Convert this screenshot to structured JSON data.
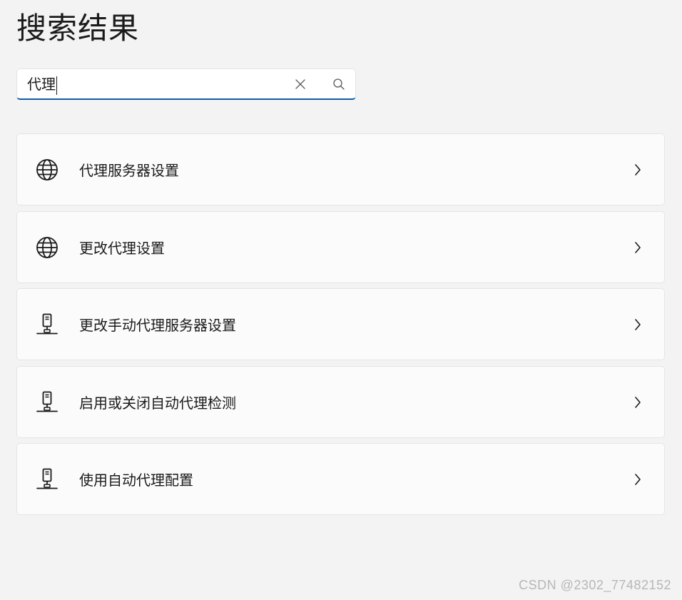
{
  "page": {
    "title": "搜索结果"
  },
  "search": {
    "value": "代理",
    "clear_icon": "close-icon",
    "search_icon": "search-icon",
    "accent_color": "#005fb8"
  },
  "results": [
    {
      "label": "代理服务器设置",
      "icon": "globe-icon"
    },
    {
      "label": "更改代理设置",
      "icon": "globe-icon"
    },
    {
      "label": "更改手动代理服务器设置",
      "icon": "network-computer-icon"
    },
    {
      "label": "启用或关闭自动代理检测",
      "icon": "network-computer-icon"
    },
    {
      "label": "使用自动代理配置",
      "icon": "network-computer-icon"
    }
  ],
  "watermark": "CSDN @2302_77482152"
}
